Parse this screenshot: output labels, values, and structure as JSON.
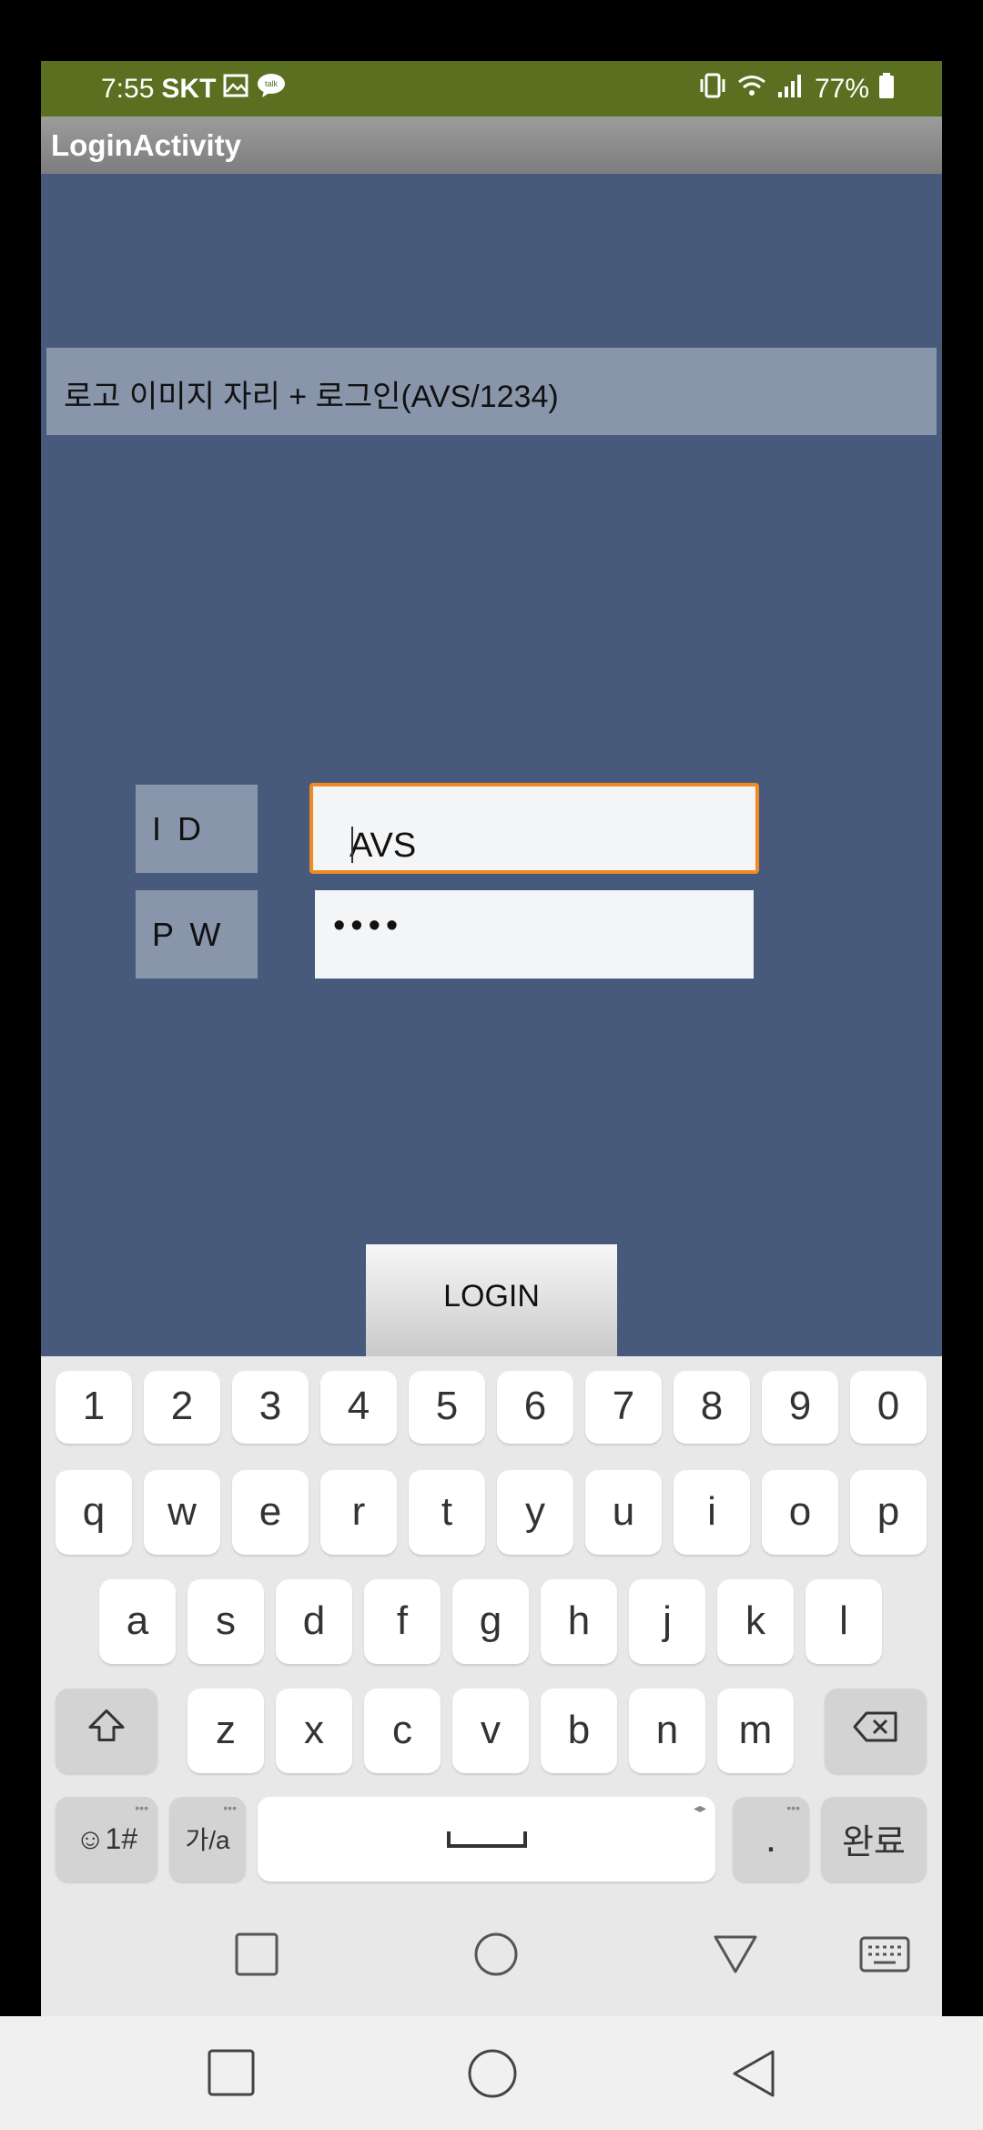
{
  "status_bar": {
    "time": "7:55",
    "carrier": "SKT",
    "battery": "77%"
  },
  "app_bar": {
    "title": "LoginActivity"
  },
  "banner": {
    "text": "로고 이미지 자리 + 로그인(AVS/1234)"
  },
  "form": {
    "id_label": "I D",
    "id_value": "AVS",
    "pw_label": "P W",
    "pw_value": "••••",
    "login_label": "LOGIN"
  },
  "keyboard": {
    "row1": [
      "1",
      "2",
      "3",
      "4",
      "5",
      "6",
      "7",
      "8",
      "9",
      "0"
    ],
    "row2": [
      "q",
      "w",
      "e",
      "r",
      "t",
      "y",
      "u",
      "i",
      "o",
      "p"
    ],
    "row3": [
      "a",
      "s",
      "d",
      "f",
      "g",
      "h",
      "j",
      "k",
      "l"
    ],
    "row4": [
      "z",
      "x",
      "c",
      "v",
      "b",
      "n",
      "m"
    ],
    "emoji_key": "☺1#",
    "lang_key": "가/a",
    "space_key": "␣",
    "period_key": ".",
    "done_key": "완료"
  },
  "icons": {
    "gallery": "gallery-icon",
    "chat": "chat-icon",
    "vibrate": "vibrate-icon",
    "wifi": "wifi-icon",
    "signal": "signal-icon",
    "battery": "battery-icon"
  },
  "colors": {
    "status_bar": "#5a6f1f",
    "background": "#485a7b",
    "focus": "#f08a24"
  }
}
